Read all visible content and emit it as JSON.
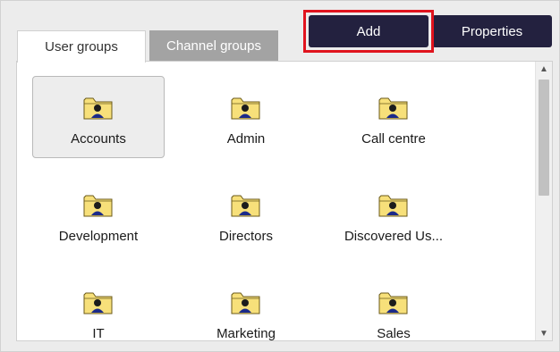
{
  "tabs": [
    {
      "label": "User groups",
      "active": true
    },
    {
      "label": "Channel groups",
      "active": false
    }
  ],
  "toolbar": {
    "add_label": "Add",
    "properties_label": "Properties"
  },
  "groups": [
    {
      "label": "Accounts",
      "selected": true
    },
    {
      "label": "Admin"
    },
    {
      "label": "Call centre"
    },
    {
      "label": "Development"
    },
    {
      "label": "Directors"
    },
    {
      "label": "Discovered Us..."
    },
    {
      "label": "IT"
    },
    {
      "label": "Marketing"
    },
    {
      "label": "Sales"
    }
  ],
  "icons": {
    "group": "user-group-folder-icon",
    "scroll_up": "chevron-up-icon",
    "scroll_down": "chevron-down-icon"
  },
  "colors": {
    "button_bg": "#23213f",
    "highlight": "#e0141e",
    "inactive_tab": "#a3a3a3"
  }
}
